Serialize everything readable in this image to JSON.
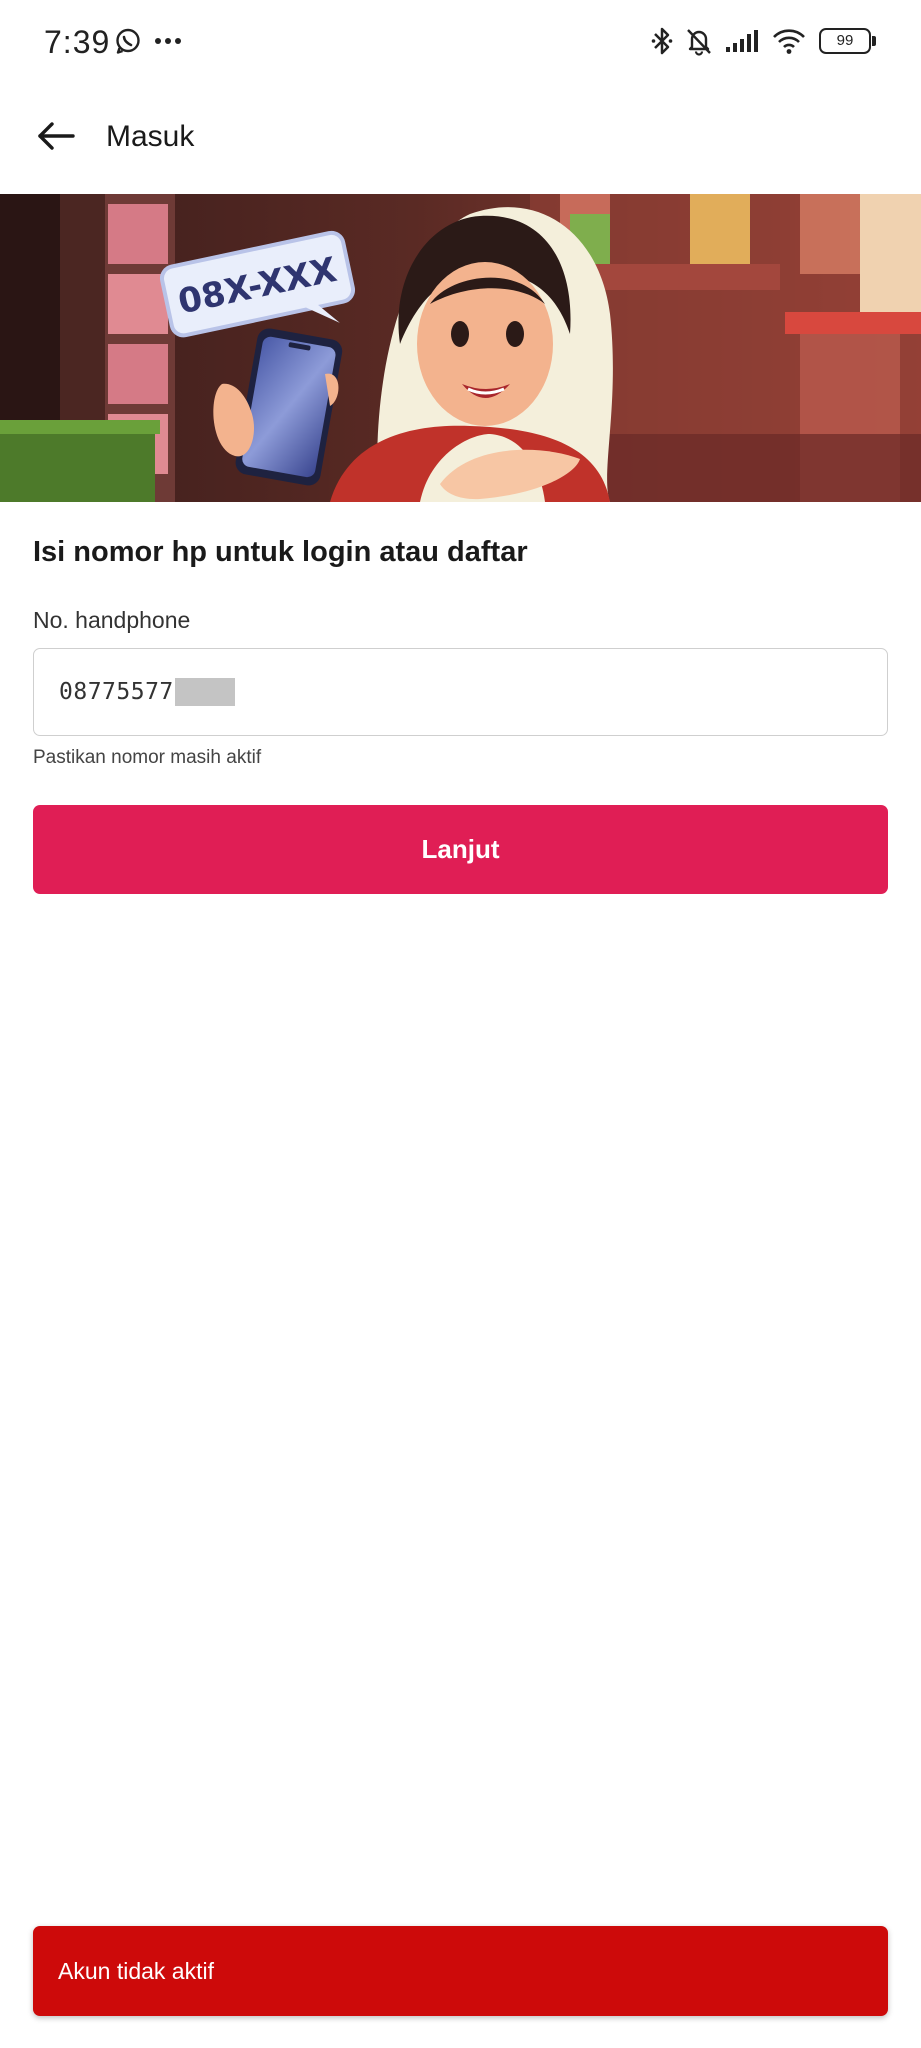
{
  "status_bar": {
    "time": "7:39",
    "left_icons": [
      "whatsapp-icon",
      "more-dots-icon"
    ],
    "right_icons": [
      "bluetooth-icon",
      "bell-muted-icon",
      "signal-icon",
      "wifi-icon"
    ],
    "battery_level": "99"
  },
  "app_bar": {
    "back_icon": "arrow-left-icon",
    "title": "Masuk"
  },
  "banner": {
    "bubble_text": "08X-XXX"
  },
  "form": {
    "heading": "Isi nomor hp untuk login atau daftar",
    "phone_label": "No. handphone",
    "phone_value": "08775577",
    "helper_text": "Pastikan nomor masih aktif",
    "submit_label": "Lanjut"
  },
  "snackbar": {
    "message": "Akun tidak aktif"
  },
  "colors": {
    "primary": "#e01e55",
    "error": "#cd0a0a",
    "input_border": "#cfcfcf"
  }
}
